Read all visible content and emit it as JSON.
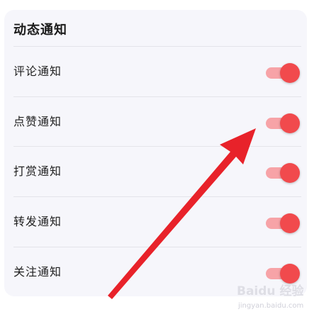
{
  "section": {
    "title": "动态通知"
  },
  "settings": [
    {
      "label": "评论通知",
      "enabled": true
    },
    {
      "label": "点赞通知",
      "enabled": true
    },
    {
      "label": "打赏通知",
      "enabled": true
    },
    {
      "label": "转发通知",
      "enabled": true
    },
    {
      "label": "关注通知",
      "enabled": true
    }
  ],
  "colors": {
    "toggle_track": "#f7a3a7",
    "toggle_knob": "#f14a4d",
    "arrow": "#e8222a",
    "card_background": "#f6f6fb"
  },
  "watermark": {
    "brand": "Baidu 经验",
    "site": "jingyan.baidu.com"
  }
}
